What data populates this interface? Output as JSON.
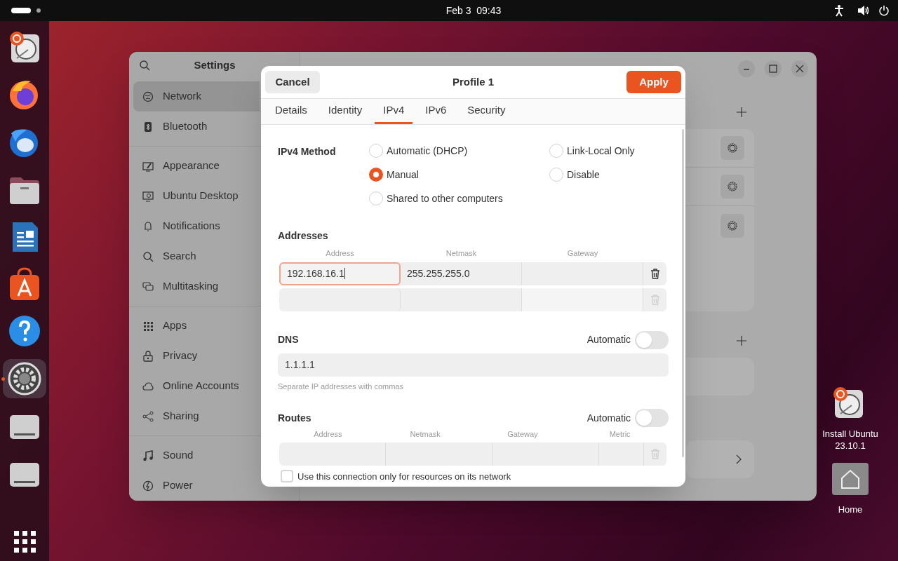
{
  "top_bar": {
    "clock": "Feb 3  09:43"
  },
  "dock": [
    {
      "kind": "installer",
      "active": false
    },
    {
      "kind": "firefox",
      "active": false
    },
    {
      "kind": "mail",
      "active": false
    },
    {
      "kind": "files",
      "active": false
    },
    {
      "kind": "writer",
      "active": false
    },
    {
      "kind": "store",
      "active": false
    },
    {
      "kind": "help",
      "active": false
    },
    {
      "kind": "settings",
      "active": true
    },
    {
      "kind": "drive",
      "active": false
    },
    {
      "kind": "drive",
      "active": false
    },
    {
      "kind": "apps",
      "active": false
    }
  ],
  "settings": {
    "title": "Settings",
    "sidebar": [
      [
        {
          "kind": "network",
          "label": "Network",
          "selected": true
        },
        {
          "kind": "bluetooth",
          "label": "Bluetooth",
          "selected": false
        }
      ],
      [
        {
          "kind": "appearance",
          "label": "Appearance",
          "selected": false
        },
        {
          "kind": "desktop",
          "label": "Ubuntu Desktop",
          "selected": false
        },
        {
          "kind": "bell",
          "label": "Notifications",
          "selected": false
        },
        {
          "kind": "search",
          "label": "Search",
          "selected": false
        },
        {
          "kind": "multitask",
          "label": "Multitasking",
          "selected": false
        }
      ],
      [
        {
          "kind": "apps",
          "label": "Apps",
          "selected": false
        },
        {
          "kind": "lock",
          "label": "Privacy",
          "selected": false
        },
        {
          "kind": "cloud",
          "label": "Online Accounts",
          "selected": false
        },
        {
          "kind": "share",
          "label": "Sharing",
          "selected": false
        }
      ],
      [
        {
          "kind": "music",
          "label": "Sound",
          "selected": false
        },
        {
          "kind": "power",
          "label": "Power",
          "selected": false
        }
      ]
    ]
  },
  "dialog": {
    "cancel": "Cancel",
    "title": "Profile 1",
    "apply": "Apply",
    "tabs": [
      {
        "label": "Details",
        "selected": false
      },
      {
        "label": "Identity",
        "selected": false
      },
      {
        "label": "IPv4",
        "selected": true
      },
      {
        "label": "IPv6",
        "selected": false
      },
      {
        "label": "Security",
        "selected": false
      }
    ],
    "method": {
      "label": "IPv4 Method",
      "options": [
        {
          "label": "Automatic (DHCP)",
          "selected": false
        },
        {
          "label": "Link-Local Only",
          "selected": false
        },
        {
          "label": "Manual",
          "selected": true
        },
        {
          "label": "Disable",
          "selected": false
        },
        {
          "label": "Shared to other computers",
          "selected": false
        }
      ]
    },
    "addresses": {
      "title": "Addresses",
      "columns": [
        "Address",
        "Netmask",
        "Gateway"
      ],
      "rows": [
        {
          "address": "192.168.16.1",
          "netmask": "255.255.255.0",
          "focused": true,
          "delete_disabled": false
        },
        {
          "focused": false,
          "delete_disabled": true
        }
      ]
    },
    "dns": {
      "title": "DNS",
      "automatic_label": "Automatic",
      "automatic": false,
      "value": "1.1.1.1",
      "hint": "Separate IP addresses with commas"
    },
    "routes": {
      "title": "Routes",
      "automatic_label": "Automatic",
      "automatic": false,
      "columns": [
        "Address",
        "Netmask",
        "Gateway",
        "Metric"
      ]
    },
    "only_local": {
      "label": "Use this connection only for resources on its network",
      "checked": false
    }
  },
  "desktop_icons": [
    {
      "kind": "installer",
      "label": "Install Ubuntu 23.10.1"
    },
    {
      "kind": "home",
      "label": "Home"
    }
  ]
}
